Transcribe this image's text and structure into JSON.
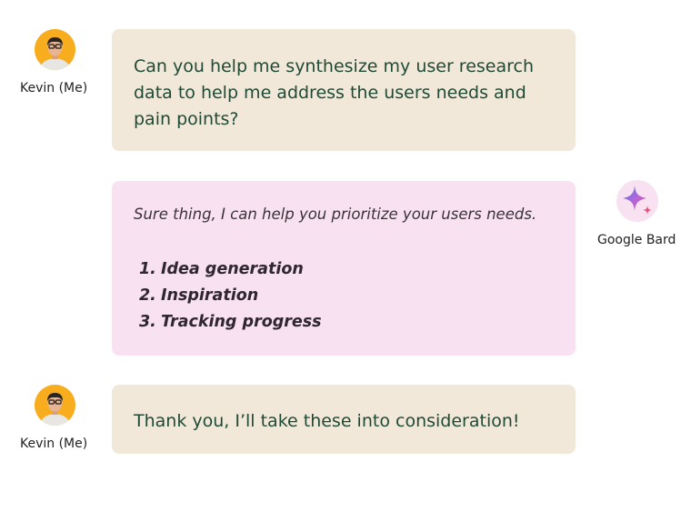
{
  "messages": [
    {
      "sender": "Kevin (Me)",
      "text": "Can you help me synthesize my user research data to help me address the users needs and pain points?"
    },
    {
      "sender": "Google Bard",
      "intro": "Sure thing, I can help you prioritize your users needs.",
      "list": [
        {
          "num": "1.",
          "label": "Idea generation"
        },
        {
          "num": "2.",
          "label": "Inspiration"
        },
        {
          "num": "3.",
          "label": "Tracking progress"
        }
      ]
    },
    {
      "sender": "Kevin (Me)",
      "text": "Thank you, I’ll take these into consideration!"
    }
  ],
  "icons": {
    "user_avatar": "user-avatar-icon",
    "bard_logo": "sparkle-icon"
  },
  "colors": {
    "user_bubble": "#f2e8d9",
    "bot_bubble": "#f8e2f2",
    "user_text": "#1f4a35",
    "avatar_bg": "#f7ad1e"
  }
}
